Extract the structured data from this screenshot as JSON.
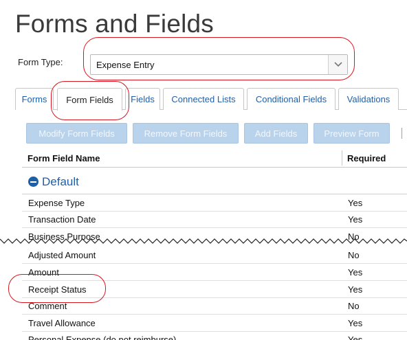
{
  "page": {
    "title": "Forms and Fields"
  },
  "form_type": {
    "label": "Form Type:",
    "value": "Expense Entry",
    "arrow_icon": "chevron-down-icon"
  },
  "tabs": [
    {
      "label": "Forms",
      "active": false
    },
    {
      "label": "Form Fields",
      "active": true
    },
    {
      "label": "Fields",
      "active": false
    },
    {
      "label": "Connected Lists",
      "active": false
    },
    {
      "label": "Conditional Fields",
      "active": false
    },
    {
      "label": "Validations",
      "active": false
    }
  ],
  "toolbar": {
    "modify": "Modify Form Fields",
    "remove": "Remove Form Fields",
    "add": "Add Fields",
    "preview": "Preview Form"
  },
  "grid": {
    "headers": {
      "name": "Form Field Name",
      "required": "Required"
    },
    "group": {
      "label": "Default",
      "icon": "collapse-minus-icon"
    },
    "rows": [
      {
        "name": "Expense Type",
        "required": "Yes"
      },
      {
        "name": "Transaction Date",
        "required": "Yes"
      },
      {
        "name": "Business Purpose",
        "required": "No"
      },
      {
        "name": "Adjusted Amount",
        "required": "No"
      },
      {
        "name": "Amount",
        "required": "Yes"
      },
      {
        "name": "Receipt Status",
        "required": "Yes"
      },
      {
        "name": "Comment",
        "required": "No"
      },
      {
        "name": "Travel Allowance",
        "required": "Yes"
      },
      {
        "name": "Personal Expense (do not reimburse)",
        "required": "Yes"
      }
    ]
  },
  "colors": {
    "link_blue": "#1f5fa8",
    "disabled_button": "#b9d3ec",
    "callout_red": "#d8141e"
  }
}
